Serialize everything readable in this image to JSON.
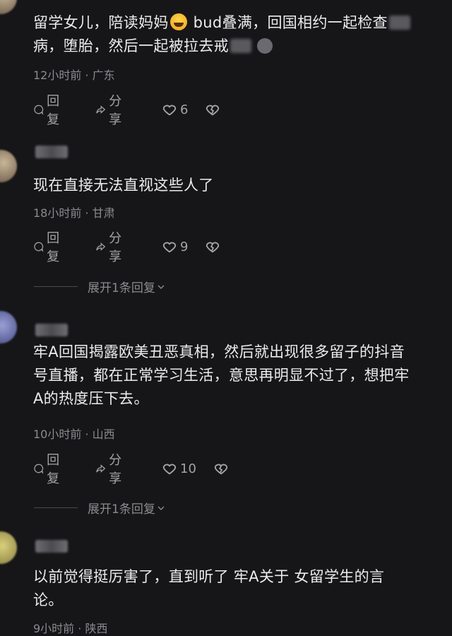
{
  "comments": [
    {
      "text_part1": "留学女儿，陪读妈妈",
      "text_part2": " bud叠满，回国相约一起检查",
      "text_line2a": "病，堕胎，然后一起被拉去戒",
      "meta": "12小时前 · 广东",
      "reply_label": "回复",
      "share_label": "分享",
      "likes": "6"
    },
    {
      "text": "现在直接无法直视这些人了",
      "meta": "18小时前 · 甘肃",
      "reply_label": "回复",
      "share_label": "分享",
      "likes": "9",
      "expand_label": "展开1条回复"
    },
    {
      "text_line1": "牢A回国揭露欧美丑恶真相，然后就出现很多留子的抖音",
      "text_line2": "号直播，都在正常学习生活，意思再明显不过了，想把牢",
      "text_line3": "A的热度压下去。",
      "meta": "10小时前 · 山西",
      "reply_label": "回复",
      "share_label": "分享",
      "likes": "10",
      "expand_label": "展开1条回复"
    },
    {
      "text_line1": "以前觉得挺厉害了，直到听了 牢A关于 女留学生的言",
      "text_line2": "论。",
      "meta": "9小时前 · 陕西"
    }
  ],
  "colors": {
    "background": "#161618",
    "text": "#ececec",
    "muted": "#8b8b90"
  },
  "icons": [
    "reply-icon",
    "share-icon",
    "like-heart-icon",
    "dislike-heart-icon",
    "chevron-down-icon"
  ]
}
